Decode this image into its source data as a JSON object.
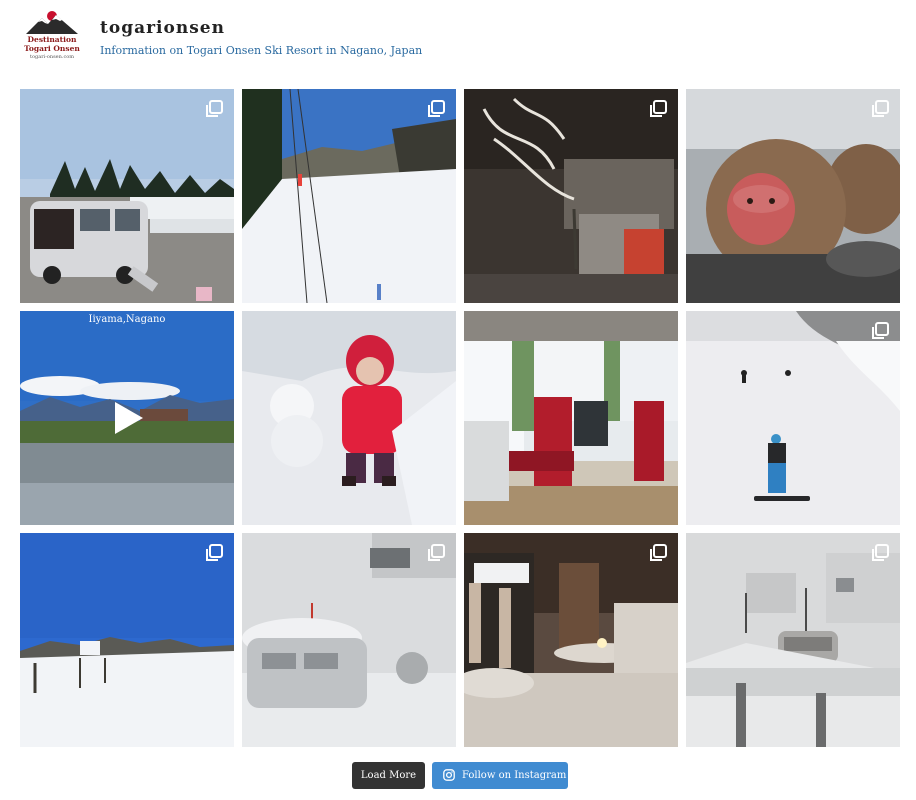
{
  "header": {
    "logo": {
      "line1": "Destination",
      "line2": "Togari Onsen",
      "line3": "togari-onsen.com"
    },
    "account_name": "togarionsen",
    "bio": "Information on Togari Onsen Ski Resort in Nagano, Japan"
  },
  "grid": {
    "posts": [
      {
        "id": 1,
        "type": "carousel",
        "scene": "minivan in snowy parking lot",
        "icon": "gallery-icon"
      },
      {
        "id": 2,
        "type": "carousel",
        "scene": "snowy ski slope with lift",
        "icon": "gallery-icon"
      },
      {
        "id": 3,
        "type": "carousel",
        "scene": "dark building with snowy tree",
        "icon": "gallery-icon"
      },
      {
        "id": 4,
        "type": "carousel",
        "scene": "snow monkeys",
        "icon": "gallery-icon"
      },
      {
        "id": 5,
        "type": "video",
        "scene": "rice paddy with train and mountains",
        "caption": "Iiyama,Nagano",
        "icon": "play-icon"
      },
      {
        "id": 6,
        "type": "image",
        "scene": "child in red jacket with snowman"
      },
      {
        "id": 7,
        "type": "image",
        "scene": "train interior with red seats"
      },
      {
        "id": 8,
        "type": "carousel",
        "scene": "snowboarder on slope",
        "icon": "gallery-icon"
      },
      {
        "id": 9,
        "type": "carousel",
        "scene": "blue sky over snowy slope",
        "icon": "gallery-icon"
      },
      {
        "id": 10,
        "type": "carousel",
        "scene": "car buried in snow",
        "icon": "gallery-icon"
      },
      {
        "id": 11,
        "type": "carousel",
        "scene": "snowy street at night",
        "icon": "gallery-icon"
      },
      {
        "id": 12,
        "type": "carousel",
        "scene": "snowy village with car",
        "icon": "gallery-icon"
      }
    ]
  },
  "actions": {
    "load_more_label": "Load More",
    "follow_label": "Follow on Instagram"
  },
  "colors": {
    "account_name": "#222222",
    "bio": "#2a6aa0",
    "load_more_bg": "#333333",
    "follow_bg": "#408bd1"
  }
}
